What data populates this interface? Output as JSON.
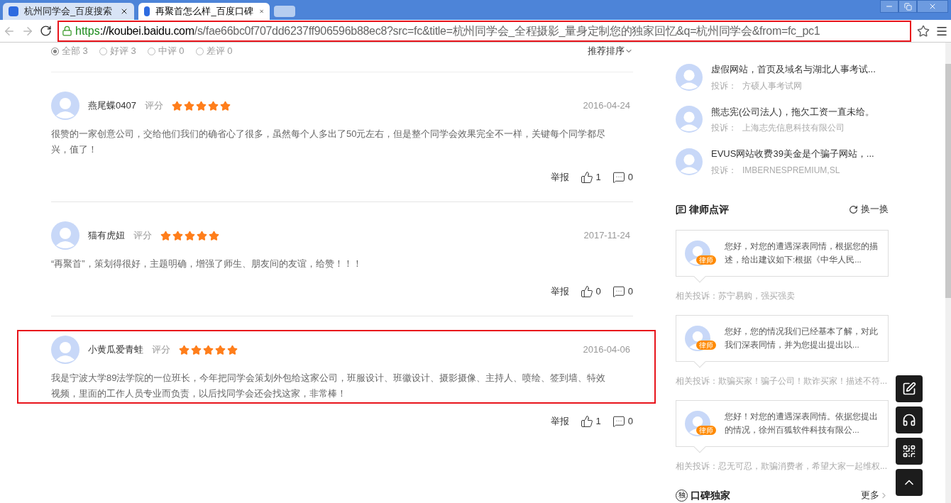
{
  "browser": {
    "tabs": [
      {
        "title": "杭州同学会_百度搜索",
        "selected": false
      },
      {
        "title": "再聚首怎么样_百度口碑",
        "selected": true
      }
    ],
    "url": {
      "scheme": "https",
      "host": "://koubei.baidu.com",
      "path": "/s/fae66bc0f707dd6237ff906596b88ec8?src=fc&title=杭州同学会_全程摄影_量身定制您的独家回忆&q=杭州同学会&from=fc_pc1",
      "highlighted": true
    }
  },
  "filters": [
    {
      "label": "全部 3",
      "selected": true
    },
    {
      "label": "好评 3",
      "selected": false
    },
    {
      "label": "中评 0",
      "selected": false
    },
    {
      "label": "差评 0",
      "selected": false
    }
  ],
  "sort": "推荐排序",
  "reviews": [
    {
      "user": "燕尾蝶0407",
      "rating_label": "评分",
      "stars": 5,
      "date": "2016-04-24",
      "text": "很赞的一家创意公司，交给他们我们的确省心了很多，虽然每个人多出了50元左右，但是整个同学会效果完全不一样，关键每个同学都尽兴，值了！",
      "report": "举报",
      "likes": "1",
      "comments": "0",
      "highlighted": false
    },
    {
      "user": "猫有虎妞",
      "rating_label": "评分",
      "stars": 5,
      "date": "2017-11-24",
      "text": "“再聚首”，策划得很好，主题明确，增强了师生、朋友间的友谊，给赞！！！",
      "report": "举报",
      "likes": "0",
      "comments": "0",
      "highlighted": false
    },
    {
      "user": "小黄瓜爱青蛙",
      "rating_label": "评分",
      "stars": 5,
      "date": "2016-04-06",
      "text": "我是宁波大学89法学院的一位班长，今年把同学会策划外包给这家公司，班服设计、班徽设计、摄影摄像、主持人、喷绘、签到墙、特效视频，里面的工作人员专业而负责，以后找同学会还会找这家，非常棒！",
      "report": "举报",
      "likes": "1",
      "comments": "0",
      "highlighted": true
    }
  ],
  "complaints": [
    {
      "title": "虚假网站，首页及域名与湖北人事考试...",
      "label": "投诉：",
      "target": "方硕人事考试网"
    },
    {
      "title": "熊志宪(公司法人)，拖欠工资一直未给。",
      "label": "投诉：",
      "target": "上海志先信息科技有限公司"
    },
    {
      "title": "EVUS网站收费39美金是个骗子网站，...",
      "label": "投诉：",
      "target": "IMBERNESPREMIUM,SL"
    }
  ],
  "lawyer_section": {
    "title": "律师点评",
    "refresh": "换一换",
    "items": [
      {
        "badge": "律师",
        "text": "您好，对您的遭遇深表同情，根据您的描述，给出建议如下:根据《中华人民...",
        "related": "相关投诉：苏宁易购，强买强卖"
      },
      {
        "badge": "律师",
        "text": "您好，您的情况我们已经基本了解，对此我们深表同情，并为您提出提出以...",
        "related": "相关投诉：欺骗买家！骗子公司！欺诈买家！描述不符..."
      },
      {
        "badge": "律师",
        "text": "您好！对您的遭遇深表同情。依据您提出的情况，徐州百狐软件科技有限公...",
        "related": "相关投诉：忍无可忍，欺骗消费者，希望大家一起维权..."
      }
    ]
  },
  "exclusive": {
    "icon": "独",
    "title": "口碑独家",
    "more": "更多"
  }
}
